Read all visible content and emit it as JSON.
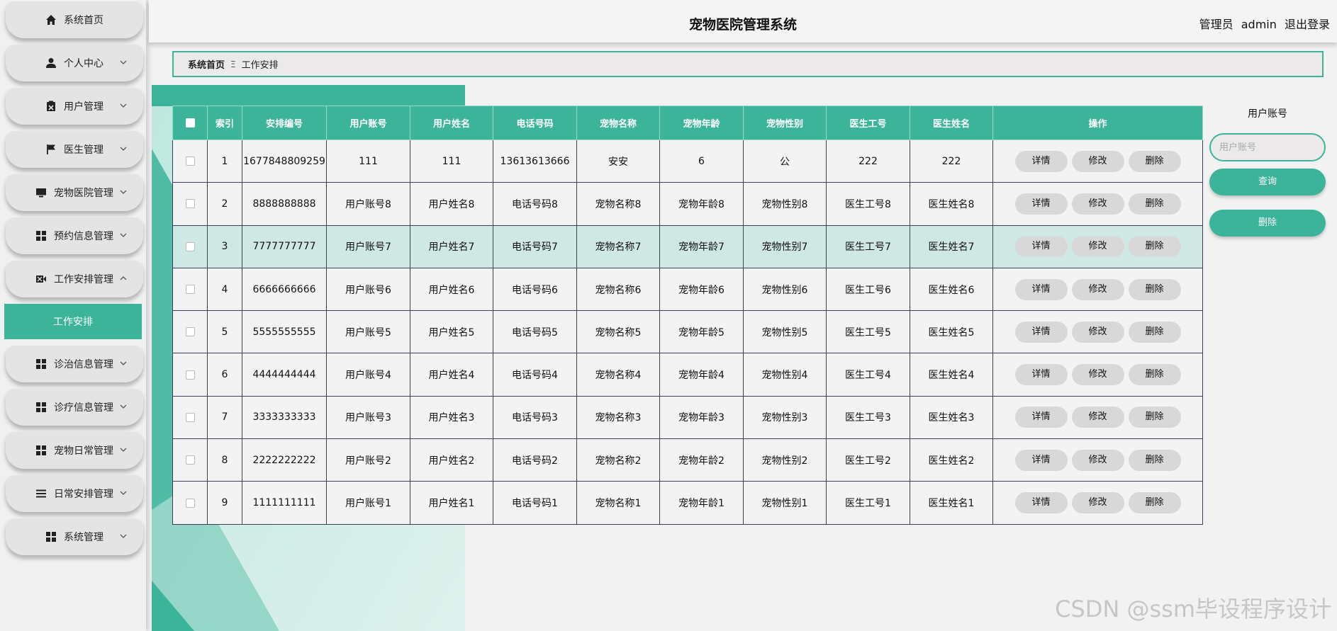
{
  "sidebar": {
    "items": [
      {
        "label": "系统首页",
        "icon": "home-icon",
        "has_chevron": false
      },
      {
        "label": "个人中心",
        "icon": "user-icon",
        "has_chevron": true
      },
      {
        "label": "用户管理",
        "icon": "clipboard-icon",
        "has_chevron": true
      },
      {
        "label": "医生管理",
        "icon": "flag-icon",
        "has_chevron": true
      },
      {
        "label": "宠物医院管理",
        "icon": "monitor-icon",
        "has_chevron": true
      },
      {
        "label": "预约信息管理",
        "icon": "grid-icon",
        "has_chevron": true
      },
      {
        "label": "工作安排管理",
        "icon": "video-icon",
        "has_chevron": true,
        "expanded": true
      },
      {
        "label": "诊治信息管理",
        "icon": "grid-icon",
        "has_chevron": true
      },
      {
        "label": "诊疗信息管理",
        "icon": "grid-icon",
        "has_chevron": true
      },
      {
        "label": "宠物日常管理",
        "icon": "grid-icon",
        "has_chevron": true
      },
      {
        "label": "日常安排管理",
        "icon": "list-icon",
        "has_chevron": true
      },
      {
        "label": "系统管理",
        "icon": "grid-icon",
        "has_chevron": true
      }
    ],
    "active_sub": "工作安排"
  },
  "header": {
    "title": "宠物医院管理系统",
    "role": "管理员",
    "username": "admin",
    "logout": "退出登录"
  },
  "breadcrumb": {
    "home": "系统首页",
    "separator": "Ξ",
    "current": "工作安排"
  },
  "table": {
    "columns": [
      "索引",
      "安排编号",
      "用户账号",
      "用户姓名",
      "电话号码",
      "宠物名称",
      "宠物年龄",
      "宠物性别",
      "医生工号",
      "医生姓名",
      "操作"
    ],
    "rows": [
      [
        "1",
        "1677848809259",
        "111",
        "111",
        "13613613666",
        "安安",
        "6",
        "公",
        "222",
        "222"
      ],
      [
        "2",
        "8888888888",
        "用户账号8",
        "用户姓名8",
        "电话号码8",
        "宠物名称8",
        "宠物年龄8",
        "宠物性别8",
        "医生工号8",
        "医生姓名8"
      ],
      [
        "3",
        "7777777777",
        "用户账号7",
        "用户姓名7",
        "电话号码7",
        "宠物名称7",
        "宠物年龄7",
        "宠物性别7",
        "医生工号7",
        "医生姓名7"
      ],
      [
        "4",
        "6666666666",
        "用户账号6",
        "用户姓名6",
        "电话号码6",
        "宠物名称6",
        "宠物年龄6",
        "宠物性别6",
        "医生工号6",
        "医生姓名6"
      ],
      [
        "5",
        "5555555555",
        "用户账号5",
        "用户姓名5",
        "电话号码5",
        "宠物名称5",
        "宠物年龄5",
        "宠物性别5",
        "医生工号5",
        "医生姓名5"
      ],
      [
        "6",
        "4444444444",
        "用户账号4",
        "用户姓名4",
        "电话号码4",
        "宠物名称4",
        "宠物年龄4",
        "宠物性别4",
        "医生工号4",
        "医生姓名4"
      ],
      [
        "7",
        "3333333333",
        "用户账号3",
        "用户姓名3",
        "电话号码3",
        "宠物名称3",
        "宠物年龄3",
        "宠物性别3",
        "医生工号3",
        "医生姓名3"
      ],
      [
        "8",
        "2222222222",
        "用户账号2",
        "用户姓名2",
        "电话号码2",
        "宠物名称2",
        "宠物年龄2",
        "宠物性别2",
        "医生工号2",
        "医生姓名2"
      ],
      [
        "9",
        "1111111111",
        "用户账号1",
        "用户姓名1",
        "电话号码1",
        "宠物名称1",
        "宠物年龄1",
        "宠物性别1",
        "医生工号1",
        "医生姓名1"
      ]
    ],
    "highlighted_row": 2,
    "actions": {
      "detail": "详情",
      "edit": "修改",
      "delete": "删除"
    }
  },
  "search": {
    "label": "用户账号",
    "placeholder": "用户账号",
    "query_button": "查询",
    "delete_button": "删除"
  },
  "watermark": "CSDN @ssm毕设程序设计",
  "colors": {
    "accent": "#3cb49a",
    "button_gray": "#d8d8d8",
    "highlight_row": "#cfe8e3"
  }
}
